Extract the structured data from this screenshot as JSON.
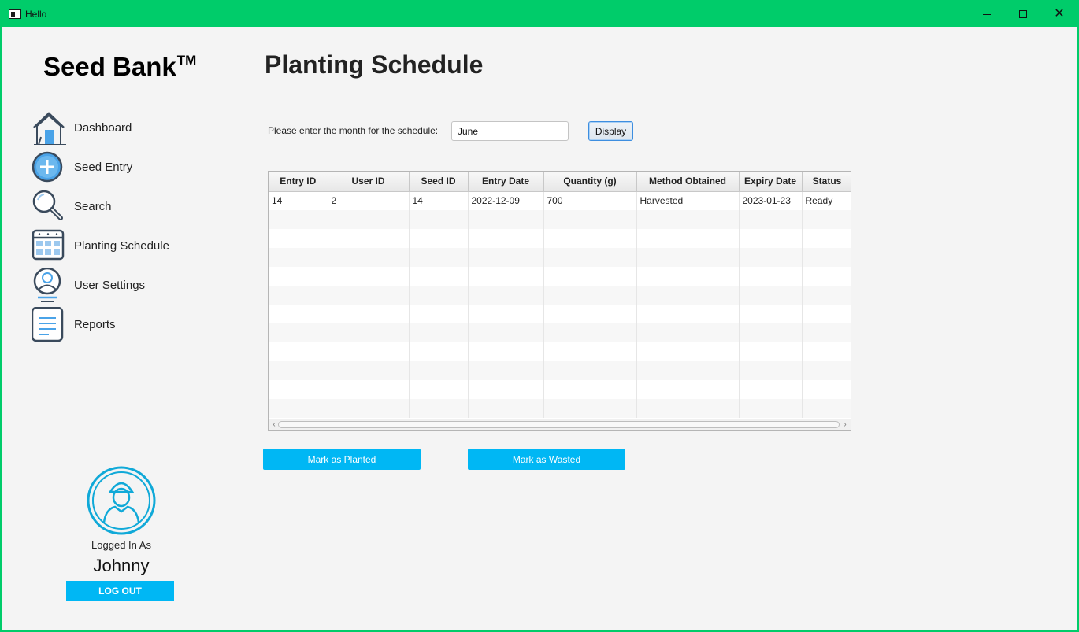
{
  "window": {
    "title": "Hello",
    "minimize_icon": "minimize-icon",
    "maximize_icon": "maximize-icon",
    "close_icon": "close-icon",
    "close_glyph": "✕"
  },
  "brand": {
    "name": "Seed Bank",
    "trademark": "TM"
  },
  "sidebar": {
    "items": [
      {
        "label": "Dashboard",
        "icon": "house-icon"
      },
      {
        "label": "Seed Entry",
        "icon": "plus-circle-icon"
      },
      {
        "label": "Search",
        "icon": "magnifier-icon"
      },
      {
        "label": "Planting Schedule",
        "icon": "calendar-icon"
      },
      {
        "label": "User Settings",
        "icon": "user-icon"
      },
      {
        "label": "Reports",
        "icon": "document-icon"
      }
    ]
  },
  "main": {
    "title": "Planting Schedule",
    "month_prompt": "Please enter the month for the schedule:",
    "month_value": "June",
    "display_label": "Display",
    "table": {
      "columns": [
        "Entry ID",
        "User ID",
        "Seed ID",
        "Entry Date",
        "Quantity (g)",
        "Method Obtained",
        "Expiry Date",
        "Status"
      ],
      "rows": [
        [
          "14",
          "2",
          "14",
          "2022-12-09",
          "700",
          "Harvested",
          "2023-01-23",
          "Ready"
        ]
      ],
      "empty_rows": 11,
      "scroll_left_glyph": "‹",
      "scroll_right_glyph": "›"
    },
    "mark_planted_label": "Mark as Planted",
    "mark_wasted_label": "Mark as Wasted"
  },
  "account": {
    "logged_in_label": "Logged In As",
    "username": "Johnny",
    "logout_label": "LOG OUT",
    "avatar_icon": "user-avatar-icon"
  },
  "colors": {
    "titlebar": "#00cc6a",
    "accent_button": "#00b7f4",
    "background": "#f4f4f4"
  }
}
